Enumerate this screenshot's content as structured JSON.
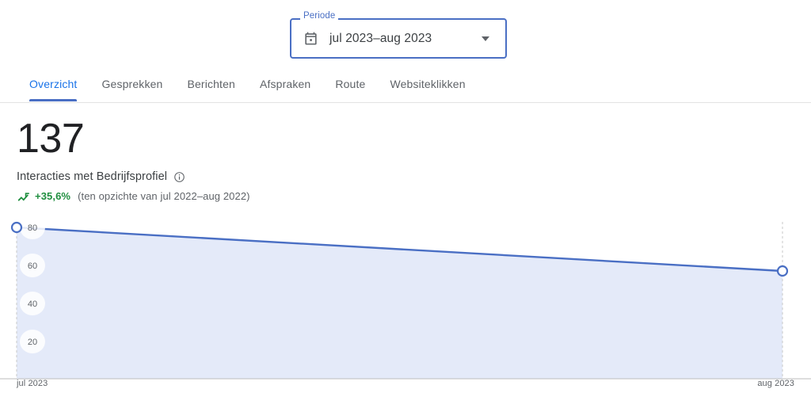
{
  "period_selector": {
    "legend": "Periode",
    "value": "jul 2023–aug 2023",
    "calendar_icon": "calendar-icon",
    "chevron_icon": "chevron-down-icon",
    "border_color": "#4a6fc4",
    "legend_color": "#4a6fc4"
  },
  "tabs": [
    {
      "label": "Overzicht",
      "active": true
    },
    {
      "label": "Gesprekken",
      "active": false
    },
    {
      "label": "Berichten",
      "active": false
    },
    {
      "label": "Afspraken",
      "active": false
    },
    {
      "label": "Route",
      "active": false
    },
    {
      "label": "Websiteklikken",
      "active": false
    }
  ],
  "metric": {
    "value": "137",
    "label": "Interacties met Bedrijfsprofiel",
    "info_icon": "info-icon",
    "trend_icon": "trending-up-icon",
    "delta": "+35,6%",
    "delta_color": "#1e8e3e",
    "comparison_note": "(ten opzichte van jul 2022–aug 2022)"
  },
  "chart_data": {
    "type": "area",
    "title": "Interacties met Bedrijfsprofiel",
    "xlabel": "",
    "ylabel": "",
    "x": [
      "jul 2023",
      "aug 2023"
    ],
    "tick_labels_x": [
      "jul 2023",
      "aug 2023"
    ],
    "tick_labels_y": [
      "20",
      "40",
      "60",
      "80"
    ],
    "yticks": [
      20,
      40,
      60,
      80
    ],
    "ylim": [
      0,
      90
    ],
    "values": [
      80,
      57
    ],
    "series": [
      {
        "name": "Interacties met Bedrijfsprofiel",
        "values": [
          80,
          57
        ]
      }
    ],
    "line_color": "#4a6fc4",
    "fill_color": "#e4eaf9",
    "marker_style": "hollow-circle",
    "grid": "vertical-dashed-endpoints",
    "legend": "none"
  },
  "colors": {
    "accent": "#1a73e8",
    "line": "#4a6fc4",
    "fill": "#e4eaf9",
    "text_primary": "#202124",
    "text_secondary": "#5f6368",
    "divider": "#e3e3e3",
    "positive": "#1e8e3e"
  }
}
